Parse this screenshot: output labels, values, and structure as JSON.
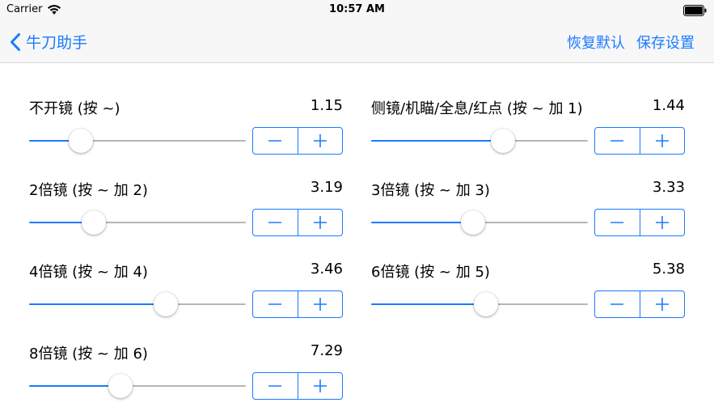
{
  "status_bar": {
    "carrier": "Carrier",
    "time": "10:57 AM"
  },
  "nav": {
    "back_label": "牛刀助手",
    "restore_label": "恢复默认",
    "save_label": "保存设置"
  },
  "colors": {
    "accent": "#1a7bff",
    "track": "#b6b6b6"
  },
  "settings": [
    {
      "label": "不开镜 (按 ~)",
      "value": "1.15",
      "slider_fraction": 0.24
    },
    {
      "label": "侧镜/机瞄/全息/红点 (按 ~ 加 1)",
      "value": "1.44",
      "slider_fraction": 0.61
    },
    {
      "label": "2倍镜 (按 ~ 加 2)",
      "value": "3.19",
      "slider_fraction": 0.3
    },
    {
      "label": "3倍镜 (按 ~ 加 3)",
      "value": "3.33",
      "slider_fraction": 0.47
    },
    {
      "label": "4倍镜 (按 ~ 加 4)",
      "value": "3.46",
      "slider_fraction": 0.63
    },
    {
      "label": "6倍镜 (按 ~ 加 5)",
      "value": "5.38",
      "slider_fraction": 0.53
    },
    {
      "label": "8倍镜 (按 ~ 加 6)",
      "value": "7.29",
      "slider_fraction": 0.42
    }
  ]
}
